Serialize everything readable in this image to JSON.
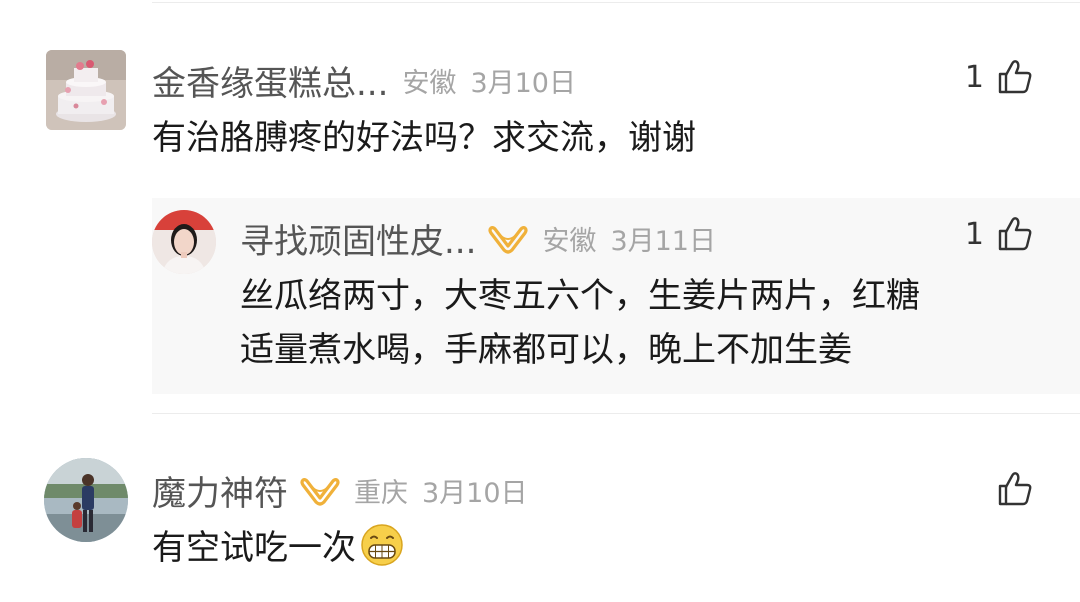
{
  "comments": [
    {
      "username": "金香缘蛋糕总...",
      "location": "安徽",
      "date": "3月10日",
      "likes": "1",
      "text": "有治胳膊疼的好法吗？求交流，谢谢",
      "avatar_icon": "cake-photo",
      "vip": false,
      "reply": {
        "username": "寻找顽固性皮...",
        "location": "安徽",
        "date": "3月11日",
        "likes": "1",
        "text_line1": "丝瓜络两寸，大枣五六个，生姜片两片，红糖",
        "text_line2": "适量煮水喝，手麻都可以，晚上不加生姜",
        "avatar_icon": "woman-portrait-photo",
        "vip": true
      }
    },
    {
      "username": "魔力神符",
      "location": "重庆",
      "date": "3月10日",
      "likes": "",
      "text": "有空试吃一次",
      "emoji": "grin-emoji",
      "avatar_icon": "person-outdoor-photo",
      "vip": true
    }
  ],
  "colors": {
    "username": "#555555",
    "meta": "#a5a5a5",
    "text": "#1a1a1a",
    "vip_badge": "#f0b13a",
    "divider": "#ececec"
  }
}
